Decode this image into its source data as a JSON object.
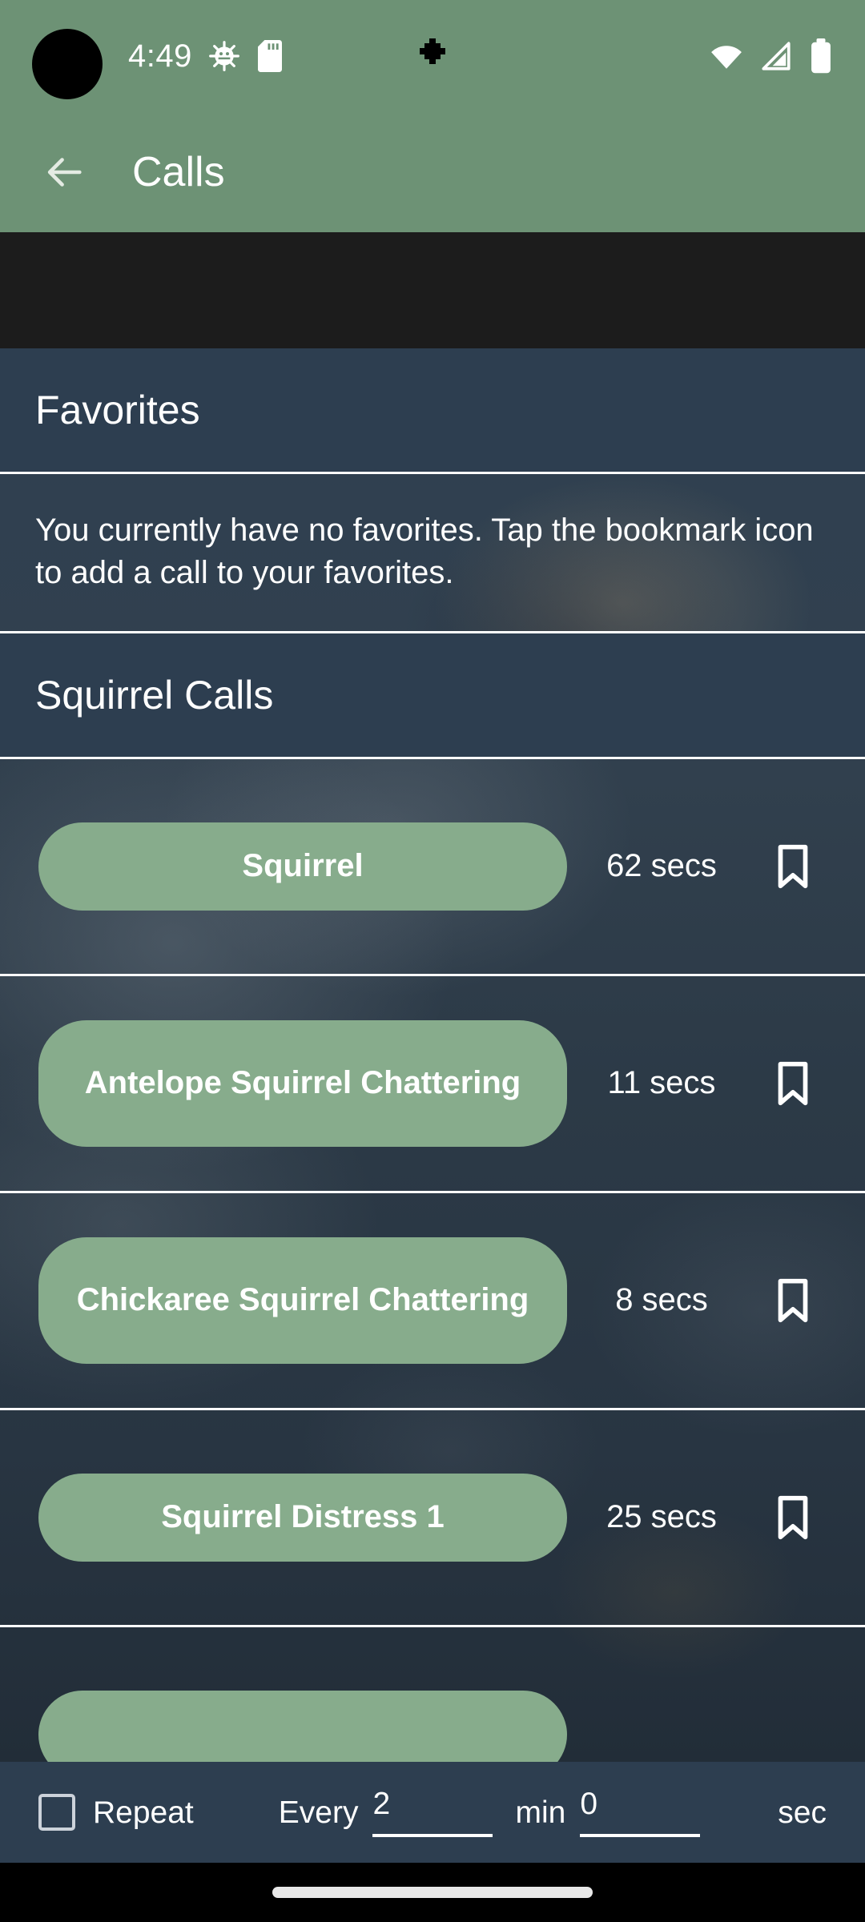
{
  "statusbar": {
    "time": "4:49",
    "icons": [
      "android-debug-icon",
      "sd-card-icon"
    ],
    "center_icon": "notification-dot-icon",
    "right_icons": [
      "wifi-icon",
      "cellular-signal-icon",
      "battery-icon"
    ]
  },
  "appbar": {
    "back_icon": "back-arrow-icon",
    "title": "Calls"
  },
  "sections": [
    {
      "id": "favorites",
      "header": "Favorites",
      "empty_message": "You currently have no favorites. Tap the bookmark icon to add a call to your favorites."
    },
    {
      "id": "squirrel-calls",
      "header": "Squirrel Calls"
    }
  ],
  "calls": [
    {
      "name": "Squirrel",
      "duration": "62 secs",
      "bookmark_icon": "bookmark-icon"
    },
    {
      "name": "Antelope Squirrel Chattering",
      "duration": "11 secs",
      "bookmark_icon": "bookmark-icon"
    },
    {
      "name": "Chickaree Squirrel Chattering",
      "duration": "8 secs",
      "bookmark_icon": "bookmark-icon"
    },
    {
      "name": "Squirrel Distress 1",
      "duration": "25 secs",
      "bookmark_icon": "bookmark-icon"
    }
  ],
  "bottombar": {
    "checkbox_state": "unchecked",
    "repeat_label": "Repeat",
    "every_label": "Every",
    "minutes_value": "2",
    "min_label": "min",
    "seconds_value": "0",
    "sec_label": "sec"
  },
  "colors": {
    "accent_green": "#6d9275",
    "button_green": "#87ac8c",
    "panel_dark": "#2d3e50",
    "band_black": "#1c1c1c",
    "text_white": "#ffffff"
  }
}
